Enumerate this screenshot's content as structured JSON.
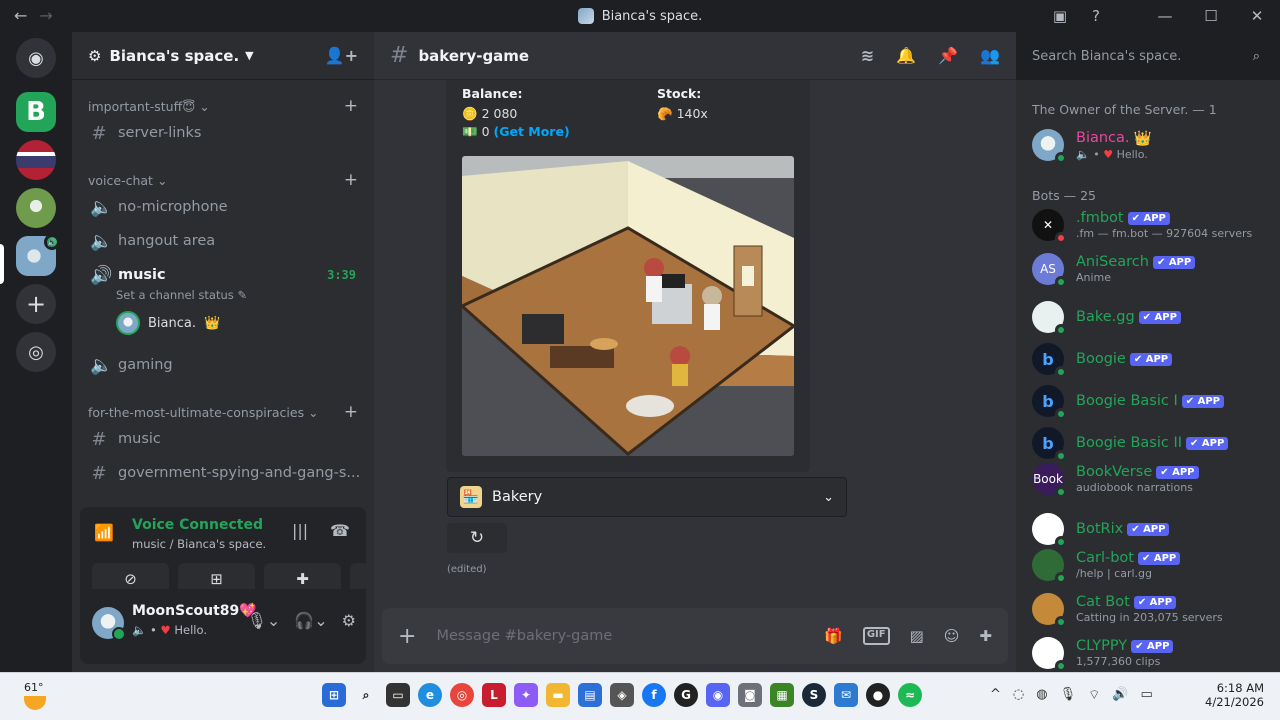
{
  "window": {
    "title": "Bianca's space."
  },
  "server": {
    "name": "Bianca's space."
  },
  "sidebar": {
    "categories": [
      {
        "label": "important-stuff😇"
      },
      {
        "label": "voice-chat"
      },
      {
        "label": "for-the-most-ultimate-conspiracies"
      }
    ],
    "channels": [
      {
        "label": "server-links"
      },
      {
        "label": "no-microphone"
      },
      {
        "label": "hangout area"
      },
      {
        "label": "music",
        "timer": "3:39",
        "status": "Set a channel status"
      },
      {
        "label": "gaming"
      },
      {
        "label": "music"
      },
      {
        "label": "government-spying-and-gang-s..."
      }
    ],
    "voice_user": "Bianca.",
    "voice_user_badge": "👑"
  },
  "voice": {
    "title": "Voice Connected",
    "sub": "music / Bianca's space."
  },
  "user": {
    "name": "MoonScout89",
    "badge": "💖",
    "status": "Hello."
  },
  "channel": {
    "name": "bakery-game"
  },
  "embed": {
    "balance_label": "Balance:",
    "balance_value": "2 080",
    "cash_value": "0",
    "get_more": "(Get More)",
    "stock_label": "Stock:",
    "stock_value": "140x"
  },
  "select": {
    "label": "Bakery"
  },
  "edited": "(edited)",
  "composer": {
    "placeholder": "Message #bakery-game",
    "gif": "GIF"
  },
  "search": {
    "placeholder": "Search Bianca's space."
  },
  "members": {
    "owner_group": "The Owner of the Server. — 1",
    "bots_group": "Bots — 25",
    "app_badge": "✔ APP",
    "owner": {
      "name": "Bianca.",
      "status": "Hello."
    },
    "bots": [
      {
        "name": ".fmbot",
        "sub": ".fm — fm.bot — 927604 servers",
        "color": "#111111",
        "initial": "✕"
      },
      {
        "name": "AniSearch",
        "sub": "Anime",
        "color": "#6b7bd6",
        "initial": "AS"
      },
      {
        "name": "Bake.gg",
        "sub": "",
        "color": "#e8f0f0",
        "initial": ""
      },
      {
        "name": "Boogie",
        "sub": "",
        "color": "#111827",
        "initial": "b"
      },
      {
        "name": "Boogie Basic I",
        "sub": "",
        "color": "#111827",
        "initial": "b"
      },
      {
        "name": "Boogie Basic II",
        "sub": "",
        "color": "#111827",
        "initial": "b"
      },
      {
        "name": "BookVerse",
        "sub": "audiobook narrations",
        "color": "#3a1b5c",
        "initial": "Book"
      },
      {
        "name": "BotRix",
        "sub": "",
        "color": "#ffffff",
        "initial": ""
      },
      {
        "name": "Carl-bot",
        "sub": "/help | carl.gg",
        "color": "#2e6b36",
        "initial": ""
      },
      {
        "name": "Cat Bot",
        "sub": "Catting in 203,075 servers",
        "color": "#c48a3a",
        "initial": ""
      },
      {
        "name": "CLYPPY",
        "sub": "1,577,360 clips",
        "color": "#ffffff",
        "initial": ""
      }
    ]
  },
  "taskbar": {
    "temp": "61°",
    "time": "6:18 AM",
    "date": "4/21/2026"
  }
}
